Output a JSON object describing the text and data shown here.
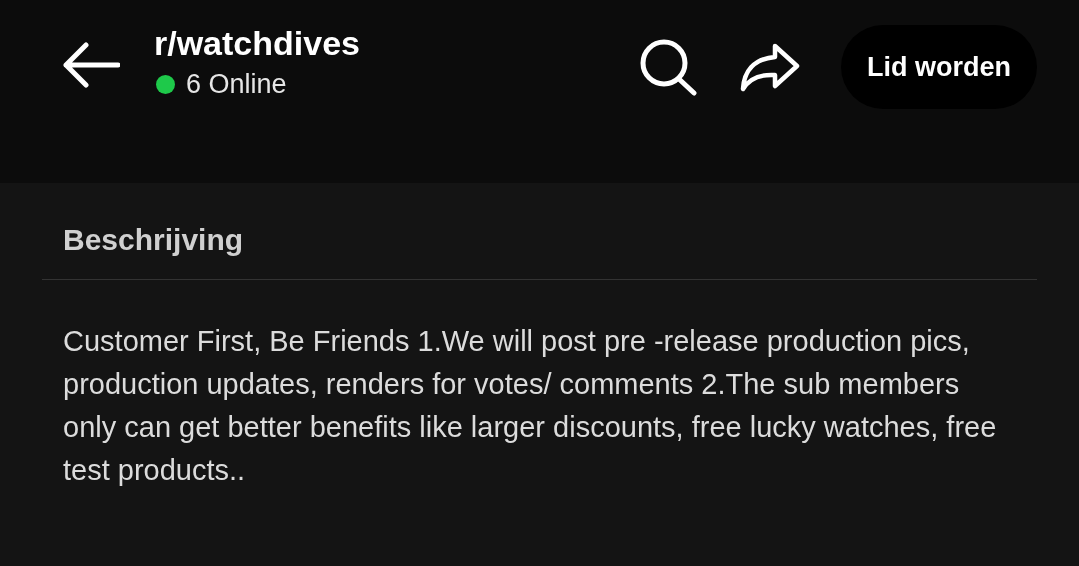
{
  "header": {
    "title": "r/watchdives",
    "online": {
      "count": "6 Online",
      "color": "#1ec94a"
    },
    "join_button": "Lid worden"
  },
  "description": {
    "heading": "Beschrijving",
    "text": "Customer First, Be Friends 1.We will post pre -release production pics, production updates, renders for votes/ comments 2.The sub members only can get better benefits like larger discounts, free lucky watches, free test products.."
  }
}
